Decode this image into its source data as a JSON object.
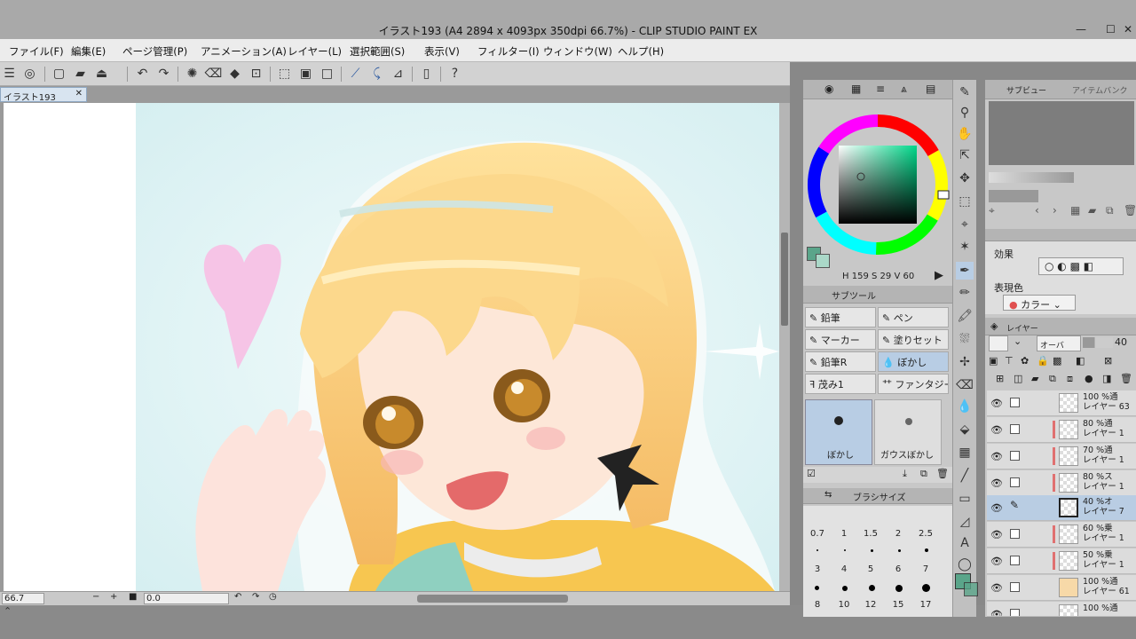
{
  "window": {
    "title": "イラスト193 (A4 2894 x 4093px 350dpi 66.7%)  - CLIP STUDIO PAINT EX",
    "minimize": "—",
    "maximize": "☐",
    "close": "✕"
  },
  "menu": [
    "ファイル(F)",
    "編集(E)",
    "ページ管理(P)",
    "アニメーション(A)",
    "レイヤー(L)",
    "選択範囲(S)",
    "表示(V)",
    "フィルター(I)",
    "ウィンドウ(W)",
    "ヘルプ(H)"
  ],
  "document_tab": {
    "label": "イラスト193",
    "close": "✕"
  },
  "status": {
    "zoom": "66.7",
    "minus": "−",
    "plus": "+",
    "angle": "0.0"
  },
  "color_panel": {
    "h_label": "H",
    "h": "159",
    "s_label": "S",
    "s": "29",
    "v_label": "V",
    "v": "60",
    "main_color": "#5aa58a",
    "sub_color": "#aad8c8"
  },
  "subtool": {
    "tab_label": "サブツール",
    "items": [
      "鉛筆",
      "ペン",
      "マーカー",
      "塗りセット",
      "鉛筆R",
      "ぼかし",
      "茂み1",
      "ファンタジー"
    ],
    "selected": "ぼかし",
    "presets": [
      "ぼかし",
      "ガウスぼかし"
    ]
  },
  "brush_size": {
    "tab_label": "ブラシサイズ",
    "values": [
      "0.7",
      "1",
      "1.5",
      "2",
      "2.5",
      "3",
      "4",
      "5",
      "6",
      "7",
      "8",
      "10",
      "12",
      "15",
      "17"
    ]
  },
  "navigator": {
    "sub_view_tab": "サブビュー",
    "item_bank_tab": "アイテムバンク"
  },
  "tool_property": {
    "effect_label": "効果",
    "expression_label": "表現色",
    "expression_value": "カラー"
  },
  "layer_panel": {
    "tab_label": "レイヤー",
    "blend_mode": "オーバ",
    "opacity": "40",
    "layers": [
      {
        "line1": "100 %通",
        "line2": "レイヤー 63",
        "selected": false
      },
      {
        "line1": "80 %通",
        "line2": "レイヤー 1",
        "selected": false
      },
      {
        "line1": "70 %通",
        "line2": "レイヤー 1",
        "selected": false
      },
      {
        "line1": "80 %ス",
        "line2": "レイヤー 1",
        "selected": false
      },
      {
        "line1": "40 %オ",
        "line2": "レイヤー 7",
        "selected": true
      },
      {
        "line1": "60 %乗",
        "line2": "レイヤー 1",
        "selected": false
      },
      {
        "line1": "50 %乗",
        "line2": "レイヤー 1",
        "selected": false
      },
      {
        "line1": "100 %通",
        "line2": "レイヤー 61",
        "selected": false
      },
      {
        "line1": "100 %通",
        "line2": "",
        "selected": false
      }
    ]
  },
  "accent": "#b8cde4"
}
